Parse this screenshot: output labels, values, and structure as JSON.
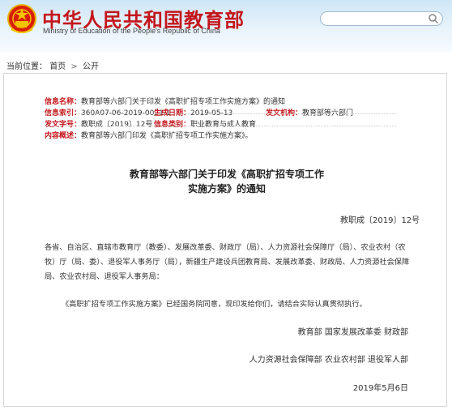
{
  "header": {
    "title_cn": "中华人民共和国教育部",
    "title_en": "Ministry of Education of the People's Republic of China",
    "search_placeholder": "",
    "colors": {
      "brand_red": "#c4161c"
    }
  },
  "breadcrumb": {
    "label": "当前位置：",
    "items": [
      "首页",
      "公开"
    ],
    "separator": ">"
  },
  "meta": {
    "info_name_label": "信息名称：",
    "info_name_value": "教育部等六部门关于印发《高职扩招专项工作实施方案》的通知",
    "index_label": "信息索引：",
    "index_value": "360A07-06-2019-0021-1",
    "date_label": "生成日期：",
    "date_value": "2019-05-13",
    "org_label": "发文机构：",
    "org_value": "教育部等六部门",
    "doc_no_label": "发文字号：",
    "doc_no_value": "教职成〔2019〕12号",
    "category_label": "信息类别：",
    "category_value": "职业教育与成人教育",
    "summary_label": "内容概述：",
    "summary_value": "教育部等六部门印发《高职扩招专项工作实施方案》。"
  },
  "document": {
    "heading_line1": "教育部等六部门关于印发《高职扩招专项工作",
    "heading_line2": "实施方案》的通知",
    "doc_no": "教职成〔2019〕12号",
    "recipients_line1": "各省、自治区、直辖市教育厅（教委）、发展改革委、财政厅（局）、人力资源社会保障厅（局）、农业农村（农",
    "recipients_line2": "牧）厅（局、委）、退役军人事务厅（局），新疆生产建设兵团教育局、发展改革委、财政局、人力资源社会保障",
    "recipients_line3": "局、农业农村局、退役军人事务局：",
    "body": "《高职扩招专项工作实施方案》已经国务院同意，现印发给你们，请结合实际认真贯彻执行。",
    "signers_line1": "教育部 国家发展改革委 财政部",
    "signers_line2": "人力资源社会保障部 农业农村部 退役军人部",
    "date": "2019年5月6日"
  }
}
